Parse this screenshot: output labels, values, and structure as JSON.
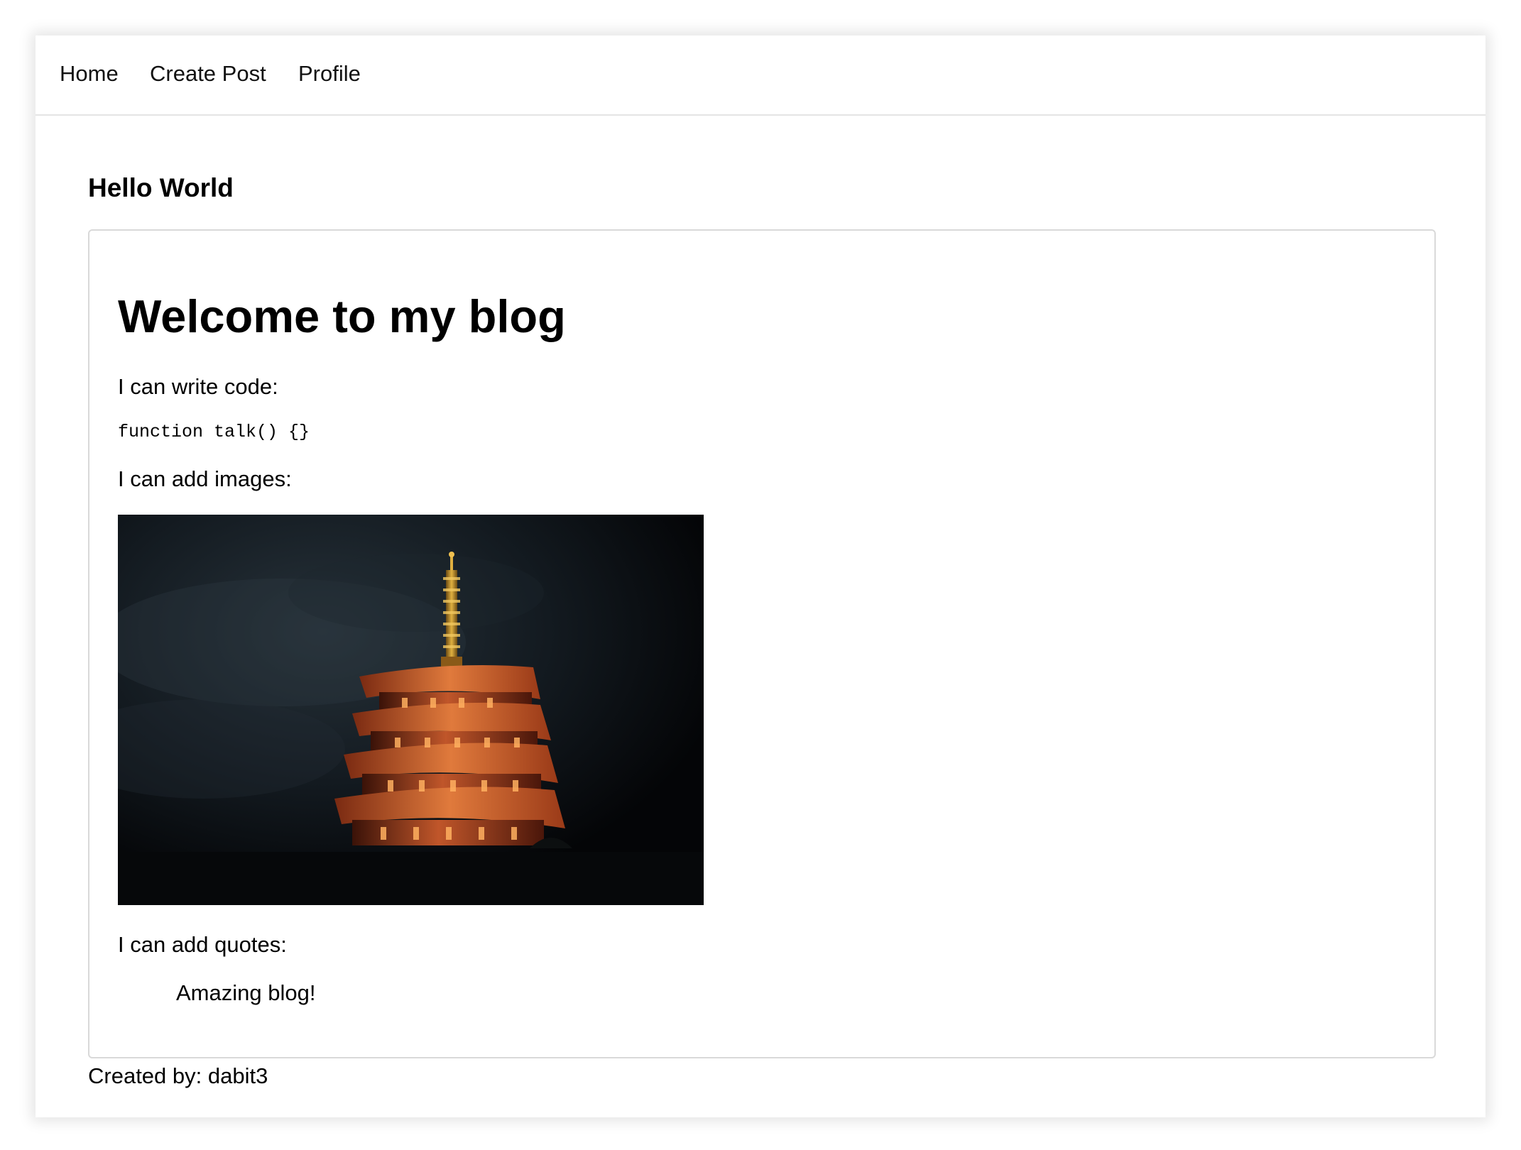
{
  "nav": {
    "home": "Home",
    "create_post": "Create Post",
    "profile": "Profile"
  },
  "post": {
    "title": "Hello World",
    "content": {
      "heading": "Welcome to my blog",
      "code_intro": "I can write code:",
      "code": "function talk() {}",
      "images_intro": "I can add images:",
      "image_icon": "pagoda-photo",
      "quotes_intro": "I can add quotes:",
      "quote": "Amazing blog!"
    },
    "author_line": "Created by: dabit3"
  }
}
